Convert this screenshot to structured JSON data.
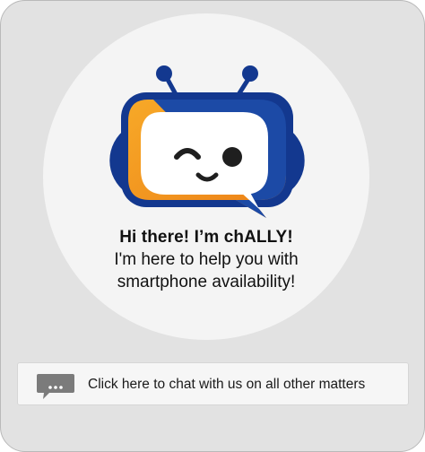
{
  "welcome": {
    "logo_icon": "chatbot-mascot-icon",
    "title": "Hi there! I’m chALLY!",
    "subtitle_line1": "I'm here to help you with",
    "subtitle_line2": "smartphone availability!"
  },
  "chat_button": {
    "icon": "chat-bubble-icon",
    "label": "Click here to chat with us on all other matters"
  },
  "colors": {
    "card_background": "#e2e2e2",
    "circle_background": "#f4f4f4",
    "bot_navy": "#13388f",
    "bot_orange": "#f39a1f",
    "chat_icon_gray": "#7b7b7b"
  }
}
